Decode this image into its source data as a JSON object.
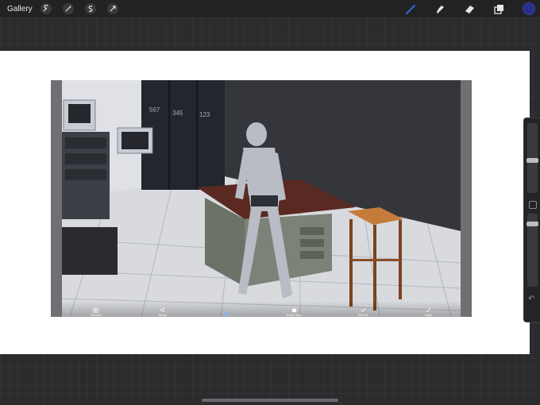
{
  "topbar": {
    "gallery_label": "Gallery",
    "left_tools": [
      "wrench-icon",
      "magic-wand-icon",
      "selection-icon",
      "transform-icon"
    ],
    "right_tools": [
      "brush-icon",
      "smudge-icon",
      "eraser-icon",
      "layers-icon"
    ],
    "active_color": "#2b2f8c",
    "active_tool_color": "#2f6bd6"
  },
  "artwork": {
    "lockers": [
      "567",
      "345",
      "123"
    ],
    "toolbar_buttons": [
      {
        "label": "Preview",
        "icon": "camera-icon"
      },
      {
        "label": "Share",
        "icon": "share-icon"
      },
      {
        "label": "",
        "icon": "figure-icon"
      },
      {
        "label": "Avoid Stop",
        "icon": "store-icon"
      },
      {
        "label": "Best fit",
        "icon": "check-icon"
      },
      {
        "label": "Save",
        "icon": "check-icon"
      }
    ]
  },
  "sidepanel": {
    "brush_size_level": 0.35,
    "opacity_level": 0.15,
    "undo_icon": "undo-icon"
  }
}
